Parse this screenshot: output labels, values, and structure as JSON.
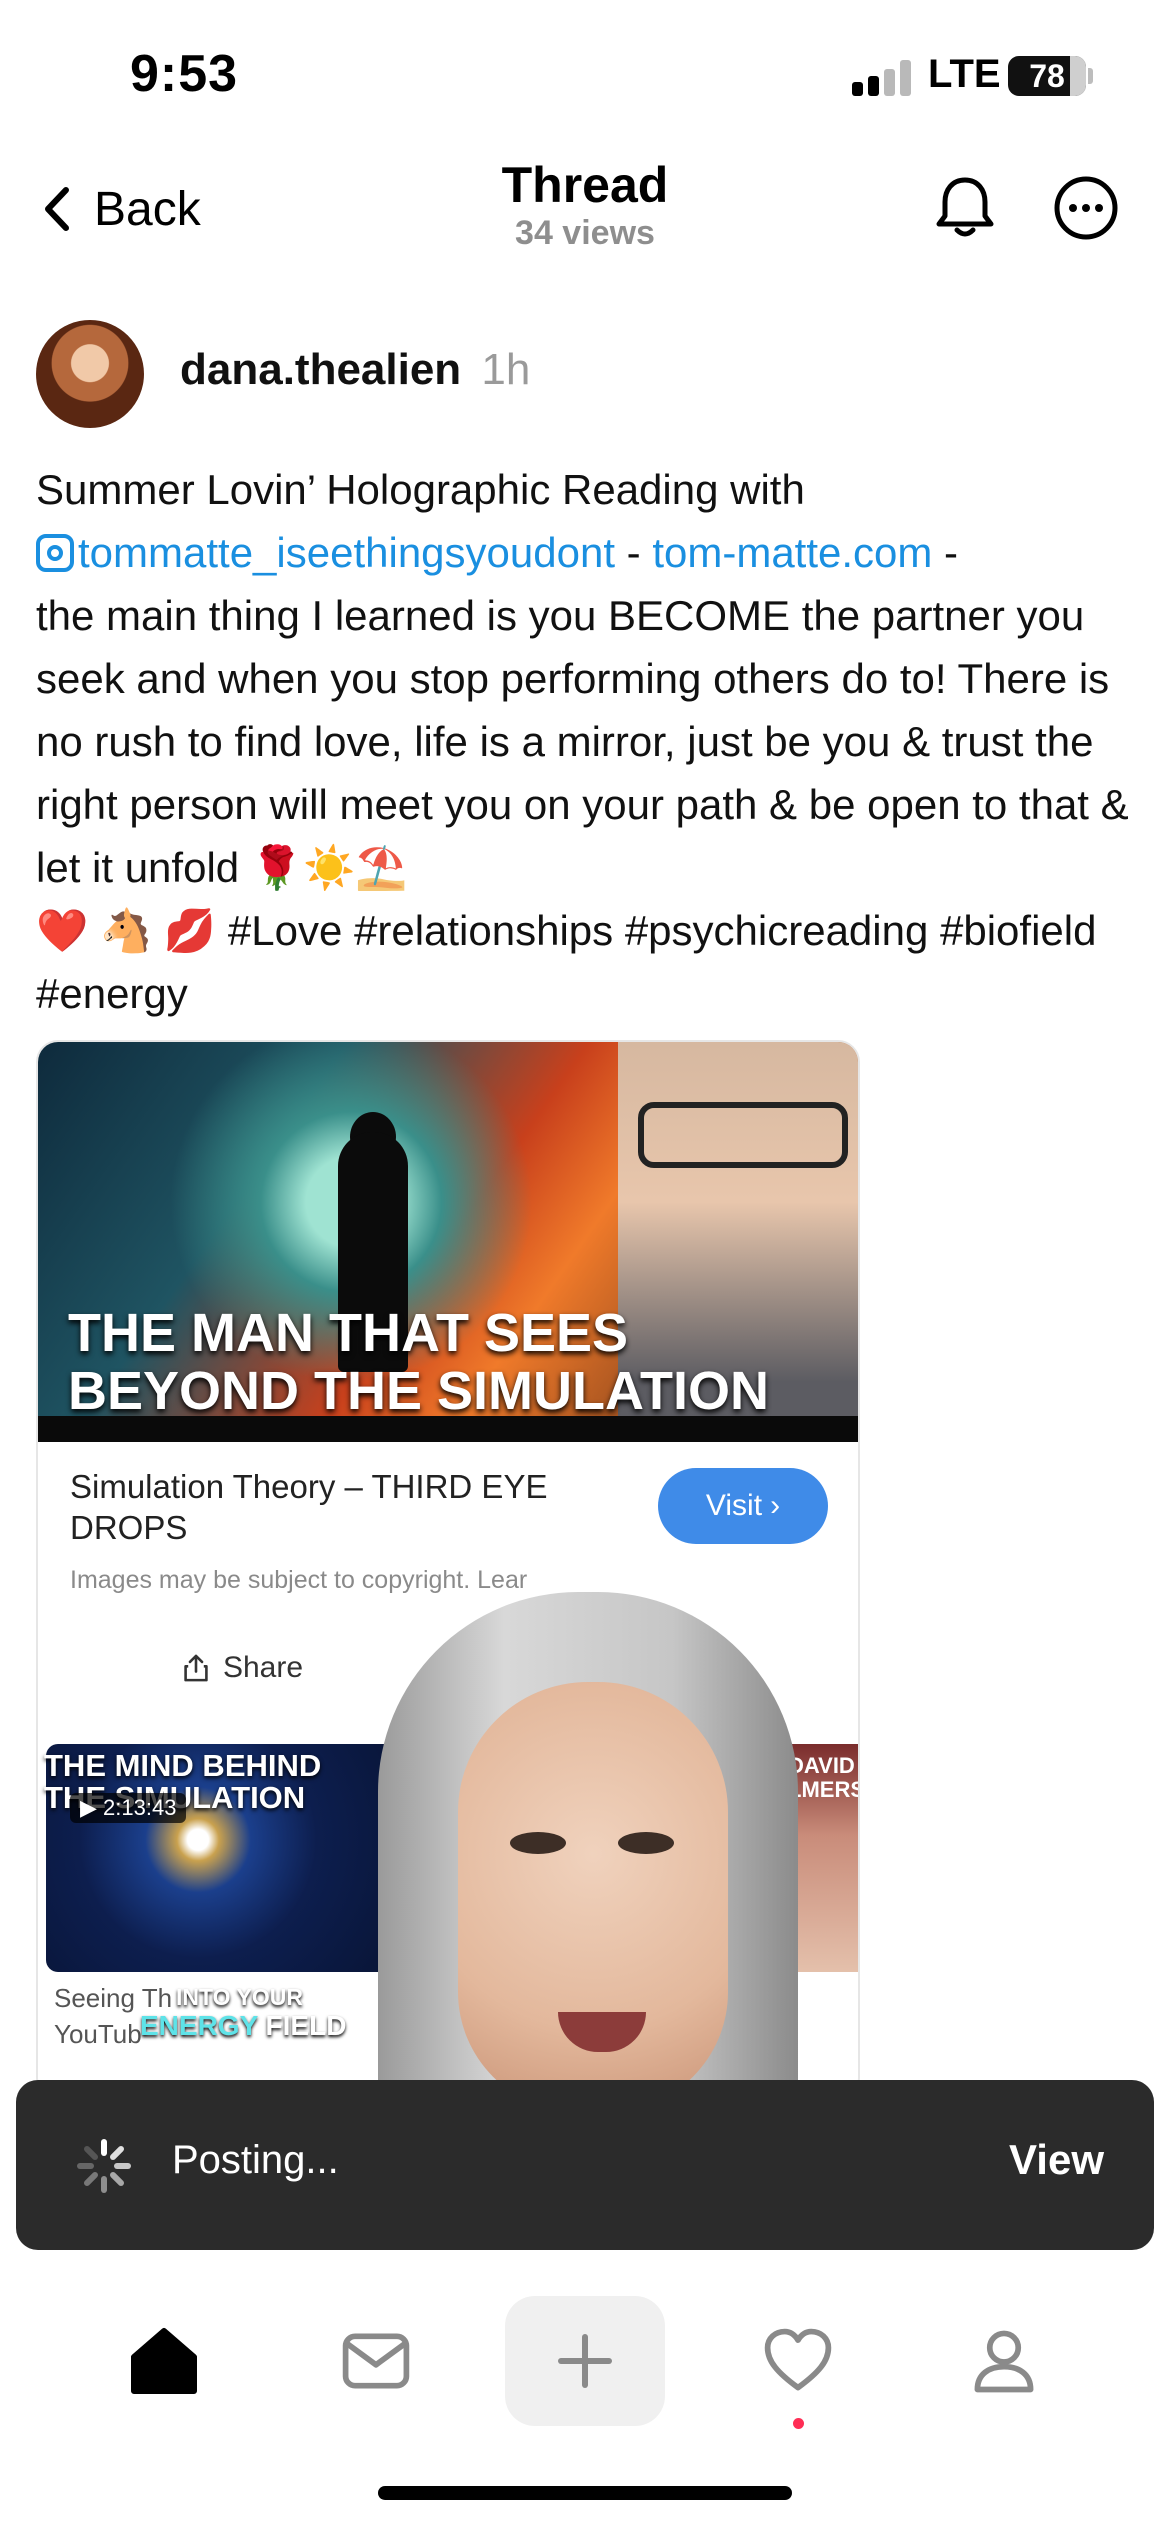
{
  "status_bar": {
    "time": "9:53",
    "network": "LTE",
    "battery": "78"
  },
  "nav": {
    "back_label": "Back",
    "title": "Thread",
    "subtitle": "34 views",
    "icons": [
      "chevron-left-icon",
      "bell-icon",
      "more-icon"
    ]
  },
  "post": {
    "author": "dana.thealien",
    "time": "1h",
    "text_1": "Summer Lovin’ Holographic Reading with",
    "mention": "tommatte_iseethingsyoudont",
    "separator_1": " - ",
    "site": "tom-matte.com",
    "separator_2": " -",
    "text_2": "the main thing I learned is you BECOME the partner you seek and when you stop performing others do to! There is no rush to find love, life is a mirror, just be you & trust the right person will meet you on your path & be open to that & let it unfold 🌹☀️⛱️",
    "text_3": "❤️ 🐴 💋 #Love #relationships #psychicreading #biofield #energy"
  },
  "media": {
    "thumb_title_line1": "THE MAN THAT SEES",
    "thumb_title_line2": "BEYOND THE SIMULATION",
    "result_title": "Simulation Theory – THIRD EYE DROPS",
    "visit_label": "Visit",
    "copyright_text": "Images may be subject to copyright. Lear",
    "share_label": "Share",
    "video_title_line1": "THE MIND BEHIND",
    "video_title_line2": "THE SIMULATION",
    "video_duration": "2:13:43",
    "video_caption_line1": "Seeing Th",
    "video_caption_line2": "YouTub",
    "right_thumb_label_1": "DAVID",
    "right_thumb_label_2": "LMERS",
    "overlay_caption_1": "INTO YOUR",
    "overlay_caption_2a": "ENERGY",
    "overlay_caption_2b": " FIELD"
  },
  "toast": {
    "text": "Posting...",
    "action": "View"
  },
  "tabbar": {
    "tabs": [
      "home-icon",
      "inbox-icon",
      "compose-icon",
      "activity-icon",
      "profile-icon"
    ]
  }
}
